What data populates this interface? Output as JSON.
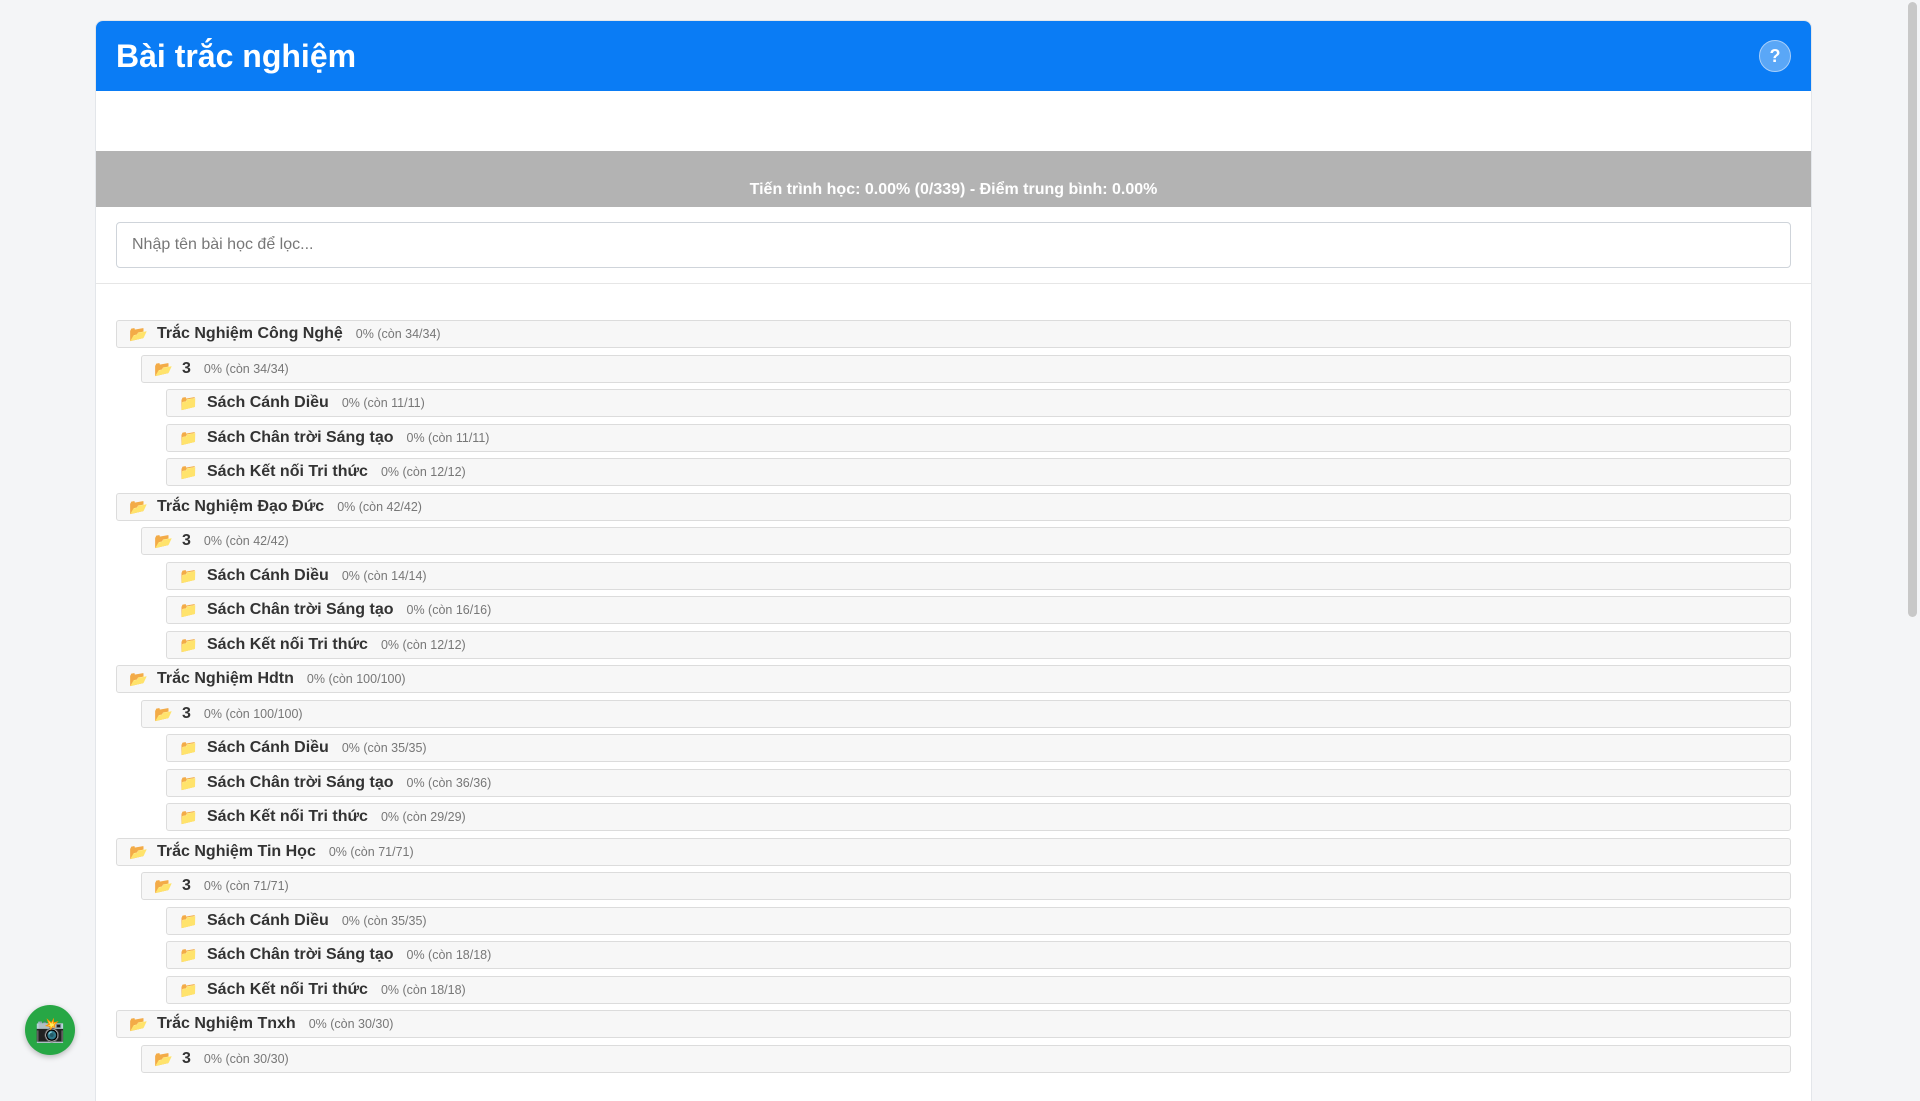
{
  "header": {
    "title": "Bài trắc nghiệm",
    "help_label": "?"
  },
  "progress": {
    "text": "Tiến trình học: 0.00% (0/339) - Điểm trung bình: 0.00%"
  },
  "filter": {
    "placeholder": "Nhập tên bài học để lọc..."
  },
  "icons": {
    "folder_open": "📂",
    "folder_closed": "📁",
    "camera": "📸"
  },
  "tree": [
    {
      "level": 0,
      "name": "Trắc Nghiệm Công Nghệ",
      "stat": "0% (còn 34/34)",
      "open": true
    },
    {
      "level": 1,
      "name": "3",
      "stat": "0% (còn 34/34)",
      "open": true
    },
    {
      "level": 2,
      "name": "Sách Cánh Diều",
      "stat": "0% (còn 11/11)",
      "open": false
    },
    {
      "level": 2,
      "name": "Sách Chân trời Sáng tạo",
      "stat": "0% (còn 11/11)",
      "open": false
    },
    {
      "level": 2,
      "name": "Sách Kết nối Tri thức",
      "stat": "0% (còn 12/12)",
      "open": false
    },
    {
      "level": 0,
      "name": "Trắc Nghiệm Đạo Đức",
      "stat": "0% (còn 42/42)",
      "open": true
    },
    {
      "level": 1,
      "name": "3",
      "stat": "0% (còn 42/42)",
      "open": true
    },
    {
      "level": 2,
      "name": "Sách Cánh Diều",
      "stat": "0% (còn 14/14)",
      "open": false
    },
    {
      "level": 2,
      "name": "Sách Chân trời Sáng tạo",
      "stat": "0% (còn 16/16)",
      "open": false
    },
    {
      "level": 2,
      "name": "Sách Kết nối Tri thức",
      "stat": "0% (còn 12/12)",
      "open": false
    },
    {
      "level": 0,
      "name": "Trắc Nghiệm Hdtn",
      "stat": "0% (còn 100/100)",
      "open": true
    },
    {
      "level": 1,
      "name": "3",
      "stat": "0% (còn 100/100)",
      "open": true
    },
    {
      "level": 2,
      "name": "Sách Cánh Diều",
      "stat": "0% (còn 35/35)",
      "open": false
    },
    {
      "level": 2,
      "name": "Sách Chân trời Sáng tạo",
      "stat": "0% (còn 36/36)",
      "open": false
    },
    {
      "level": 2,
      "name": "Sách Kết nối Tri thức",
      "stat": "0% (còn 29/29)",
      "open": false
    },
    {
      "level": 0,
      "name": "Trắc Nghiệm Tin Học",
      "stat": "0% (còn 71/71)",
      "open": true
    },
    {
      "level": 1,
      "name": "3",
      "stat": "0% (còn 71/71)",
      "open": true
    },
    {
      "level": 2,
      "name": "Sách Cánh Diều",
      "stat": "0% (còn 35/35)",
      "open": false
    },
    {
      "level": 2,
      "name": "Sách Chân trời Sáng tạo",
      "stat": "0% (còn 18/18)",
      "open": false
    },
    {
      "level": 2,
      "name": "Sách Kết nối Tri thức",
      "stat": "0% (còn 18/18)",
      "open": false
    },
    {
      "level": 0,
      "name": "Trắc Nghiệm Tnxh",
      "stat": "0% (còn 30/30)",
      "open": true
    },
    {
      "level": 1,
      "name": "3",
      "stat": "0% (còn 30/30)",
      "open": true
    }
  ]
}
